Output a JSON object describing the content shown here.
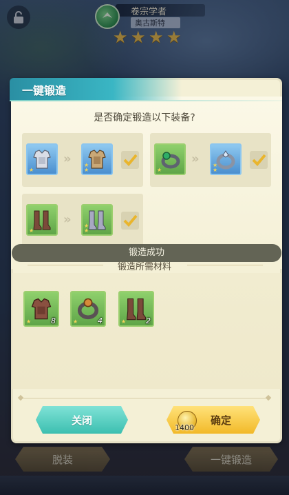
{
  "header": {
    "hero_name": "卷宗学者",
    "hero_subtitle": "奥古斯特",
    "stars": 4,
    "lock_icon": "lock-icon"
  },
  "dialog": {
    "title": "一键锻造",
    "question": "是否确定锻造以下装备?",
    "upgrades": [
      {
        "from": "chest-armor",
        "to": "chest-armor",
        "from_rarity": "blue",
        "to_rarity": "blue",
        "checked": true
      },
      {
        "from": "ring",
        "to": "ring",
        "from_rarity": "green",
        "to_rarity": "blue",
        "checked": true
      },
      {
        "from": "boots",
        "to": "boots",
        "from_rarity": "green",
        "to_rarity": "green",
        "checked": true
      }
    ],
    "toast": "锻造成功",
    "materials_title": "锻造所需材料",
    "materials": [
      {
        "item": "leather-armor",
        "count": "8"
      },
      {
        "item": "ring",
        "count": "4"
      },
      {
        "item": "boots",
        "count": "2"
      }
    ],
    "close_label": "关闭",
    "confirm_label": "确定",
    "cost": "1400"
  },
  "bottom_bar": {
    "unequip_label": "脱装",
    "forge_all_label": "一键锻造"
  },
  "colors": {
    "title_bar": "#3ab6c4",
    "dialog_bg": "#f4f0d6",
    "close_button": "#3cbfb0",
    "confirm_button": "#f2b928",
    "green_slot": "#5fa548",
    "blue_slot": "#4a8fcf"
  }
}
